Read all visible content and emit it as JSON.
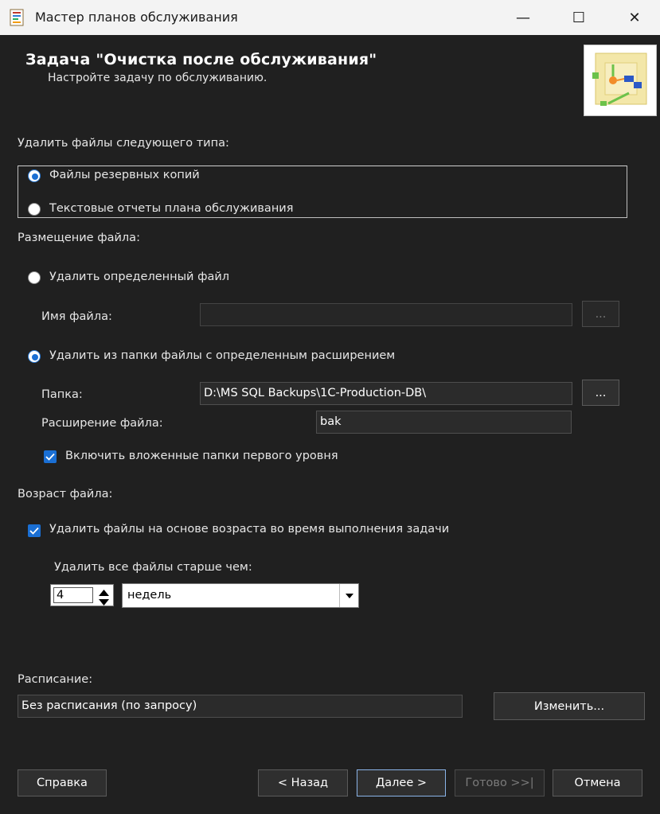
{
  "window": {
    "title": "Мастер планов обслуживания",
    "controls": {
      "minimize": "—",
      "maximize": "☐",
      "close": "✕"
    }
  },
  "header": {
    "title": "Задача \"Очистка после обслуживания\"",
    "subtitle": "Настройте задачу по обслуживанию."
  },
  "file_type": {
    "label": "Удалить файлы следующего типа:",
    "options": [
      {
        "label": "Файлы резервных копий",
        "selected": true
      },
      {
        "label": "Текстовые отчеты плана обслуживания",
        "selected": false
      }
    ]
  },
  "file_location": {
    "label": "Размещение файла:",
    "specific_file": {
      "label": "Удалить определенный файл",
      "selected": false
    },
    "file_name": {
      "label": "Имя файла:",
      "value": "",
      "browse": "..."
    },
    "by_extension": {
      "label": "Удалить из папки файлы с определенным расширением",
      "selected": true
    },
    "folder": {
      "label": "Папка:",
      "value": "D:\\MS SQL Backups\\1C-Production-DB\\",
      "browse": "..."
    },
    "extension": {
      "label": "Расширение файла:",
      "value": "bak"
    },
    "include_subfolders": {
      "label": "Включить вложенные папки первого уровня",
      "checked": true
    }
  },
  "file_age": {
    "label": "Возраст файла:",
    "delete_by_age": {
      "label": "Удалить файлы на основе возраста во время выполнения задачи",
      "checked": true
    },
    "older_than_label": "Удалить все файлы старше чем:",
    "amount": "4",
    "unit": "недель"
  },
  "schedule": {
    "label": "Расписание:",
    "value": "Без расписания (по запросу)",
    "change_button": "Изменить..."
  },
  "footer": {
    "help": "Справка",
    "back": "< Назад",
    "next": "Далее >",
    "finish": "Готово >>|",
    "cancel": "Отмена"
  },
  "colors": {
    "accent": "#1a6fd4",
    "background": "#202020",
    "titlebar": "#f3f3f3"
  }
}
